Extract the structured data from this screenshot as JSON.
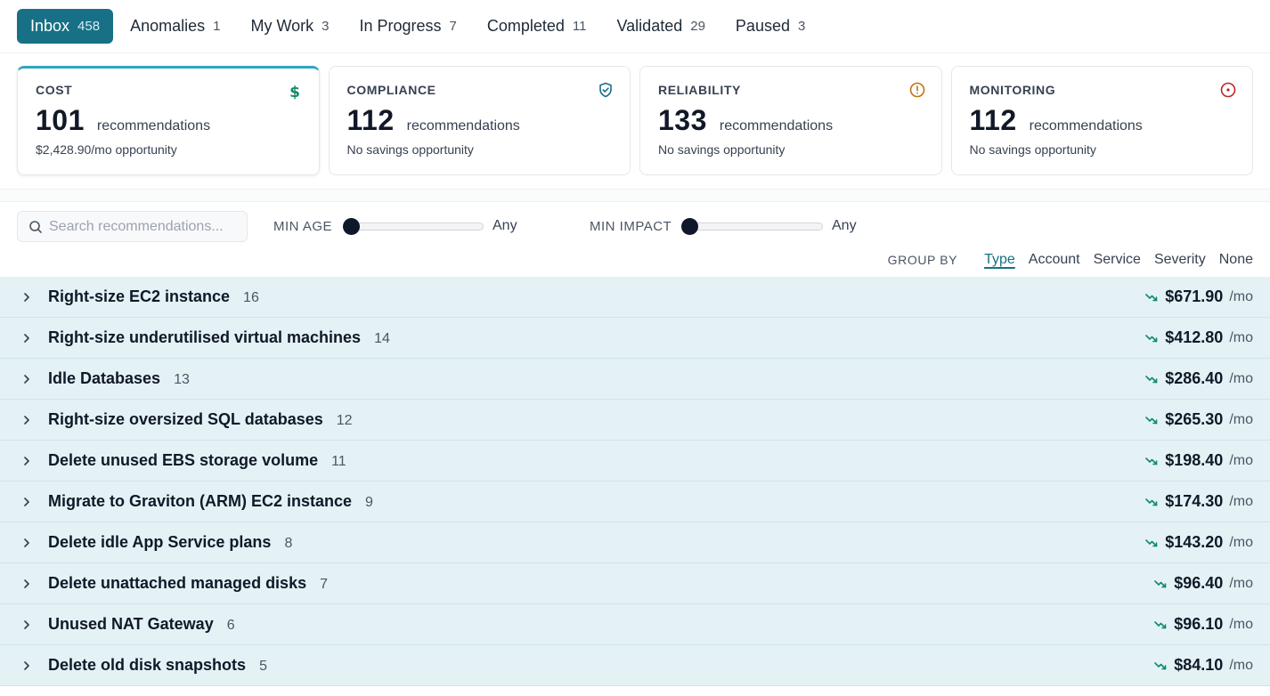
{
  "tabs": [
    {
      "label": "Inbox",
      "count": "458"
    },
    {
      "label": "Anomalies",
      "count": "1"
    },
    {
      "label": "My Work",
      "count": "3"
    },
    {
      "label": "In Progress",
      "count": "7"
    },
    {
      "label": "Completed",
      "count": "11"
    },
    {
      "label": "Validated",
      "count": "29"
    },
    {
      "label": "Paused",
      "count": "3"
    }
  ],
  "cards": [
    {
      "title": "COST",
      "number": "101",
      "unit": "recommendations",
      "sub": "$2,428.90/mo opportunity",
      "icon": "dollar-icon",
      "color": "#0f8a6a"
    },
    {
      "title": "COMPLIANCE",
      "number": "112",
      "unit": "recommendations",
      "sub": "No savings opportunity",
      "icon": "shield-check-icon",
      "color": "#187086"
    },
    {
      "title": "RELIABILITY",
      "number": "133",
      "unit": "recommendations",
      "sub": "No savings opportunity",
      "icon": "alert-circle-icon",
      "color": "#c2710c"
    },
    {
      "title": "MONITORING",
      "number": "112",
      "unit": "recommendations",
      "sub": "No savings opportunity",
      "icon": "target-icon",
      "color": "#c0261e"
    }
  ],
  "filters": {
    "search_placeholder": "Search recommendations...",
    "min_age_label": "MIN AGE",
    "min_age_value": "Any",
    "min_impact_label": "MIN IMPACT",
    "min_impact_value": "Any"
  },
  "group_by": {
    "label": "GROUP BY",
    "options": [
      "Type",
      "Account",
      "Service",
      "Severity",
      "None"
    ],
    "selected": "Type"
  },
  "rows": [
    {
      "title": "Right-size EC2 instance",
      "count": "16",
      "amount": "$671.90",
      "per": "/mo"
    },
    {
      "title": "Right-size underutilised virtual machines",
      "count": "14",
      "amount": "$412.80",
      "per": "/mo"
    },
    {
      "title": "Idle Databases",
      "count": "13",
      "amount": "$286.40",
      "per": "/mo"
    },
    {
      "title": "Right-size oversized SQL databases",
      "count": "12",
      "amount": "$265.30",
      "per": "/mo"
    },
    {
      "title": "Delete unused EBS storage volume",
      "count": "11",
      "amount": "$198.40",
      "per": "/mo"
    },
    {
      "title": "Migrate to Graviton (ARM) EC2 instance",
      "count": "9",
      "amount": "$174.30",
      "per": "/mo"
    },
    {
      "title": "Delete idle App Service plans",
      "count": "8",
      "amount": "$143.20",
      "per": "/mo"
    },
    {
      "title": "Delete unattached managed disks",
      "count": "7",
      "amount": "$96.40",
      "per": "/mo"
    },
    {
      "title": "Unused NAT Gateway",
      "count": "6",
      "amount": "$96.10",
      "per": "/mo"
    },
    {
      "title": "Delete old disk snapshots",
      "count": "5",
      "amount": "$84.10",
      "per": "/mo"
    }
  ],
  "colors": {
    "accent": "#187086",
    "row_bg": "#e4f2f6",
    "trend": "#0f8a6a"
  }
}
